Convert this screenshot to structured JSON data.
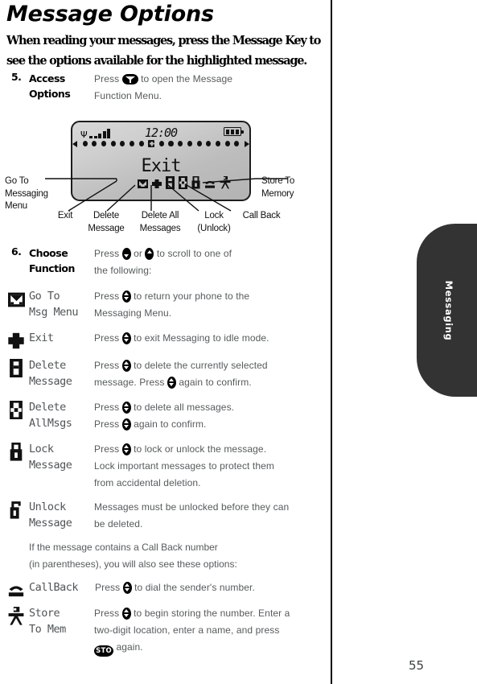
{
  "page": {
    "title": "Message Options",
    "intro": "When reading your messages, press the Message Key to see the options available for the highlighted message.",
    "number": "55",
    "side_tab_label": "Messaging"
  },
  "steps": [
    {
      "num": "5.",
      "label_line1": "Access",
      "label_line2": "Options",
      "body_part1": "Press",
      "body_part2": "to open the Message",
      "body_part3": "Function Menu.",
      "key_icon": "message-key-icon"
    },
    {
      "num": "6.",
      "label_line1": "Choose",
      "label_line2": "Function",
      "body_part1": "Press",
      "body_part2": "or",
      "body_part3": "to scroll to one of",
      "body_part4": "the following:",
      "key_icon_up": "up-arrow-key-icon",
      "key_icon_down": "down-arrow-key-icon"
    }
  ],
  "lcd": {
    "signal_icon": "signal-strength-icon",
    "clock": "12:00",
    "battery_icon": "battery-full-icon",
    "selection_text": "Exit",
    "dot_count_left": 7,
    "dot_count_right": 9,
    "icons": [
      "go-to-messaging-menu-icon",
      "exit-icon",
      "delete-message-icon",
      "delete-all-messages-icon",
      "lock-icon",
      "call-back-icon",
      "store-to-memory-icon"
    ]
  },
  "callouts": {
    "left": "Go To\nMessaging\nMenu",
    "left_l1": "Go To",
    "left_l2": "Messaging",
    "left_l3": "Menu",
    "right_l1": "Store To",
    "right_l2": "Memory",
    "bottom": [
      {
        "l1": "Exit",
        "l2": ""
      },
      {
        "l1": "Delete",
        "l2": "Message"
      },
      {
        "l1": "Delete All",
        "l2": "Messages"
      },
      {
        "l1": "Lock",
        "l2": "(Unlock)"
      },
      {
        "l1": "Call Back",
        "l2": ""
      }
    ]
  },
  "functions": [
    {
      "icon": "go-to-messaging-menu-icon",
      "name_l1": "Go To",
      "name_l2": "Msg Menu",
      "desc_pre": "Press",
      "desc_post": "to return your phone to the",
      "desc_line2": "Messaging Menu."
    },
    {
      "icon": "exit-icon",
      "name_l1": "Exit",
      "name_l2": "",
      "desc_pre": "Press",
      "desc_post": "to exit Messaging to idle mode.",
      "desc_line2": ""
    },
    {
      "icon": "delete-message-icon",
      "name_l1": "Delete",
      "name_l2": "Message",
      "desc_pre": "Press",
      "desc_post": "to delete the currently selected",
      "desc_line2_pre": "message. Press",
      "desc_line2_post": "again to confirm."
    },
    {
      "icon": "delete-all-messages-icon",
      "name_l1": "Delete",
      "name_l2": "AllMsgs",
      "desc_pre": "Press",
      "desc_post": "to delete all messages.",
      "desc_line2_pre": "Press",
      "desc_line2_post": "again to confirm."
    },
    {
      "icon": "lock-message-icon",
      "name_l1": "Lock",
      "name_l2": "Message",
      "desc_pre": "Press",
      "desc_post": "to lock or unlock the message.",
      "desc_line2": "Lock important messages to protect them",
      "desc_line3": "from accidental deletion."
    },
    {
      "icon": "unlock-message-icon",
      "name_l1": "Unlock",
      "name_l2": "Message",
      "desc_line1": "Messages must be unlocked before they can",
      "desc_line2": "be deleted."
    },
    {
      "icon": "call-back-icon",
      "name_l1": "CallBack",
      "name_l2": "",
      "desc_pre": "Press",
      "desc_post": "to dial the sender's number."
    },
    {
      "icon": "store-to-memory-icon",
      "name_l1": "Store",
      "name_l2": "To Mem",
      "desc_pre": "Press",
      "desc_post": "to begin storing the number. Enter a",
      "desc_line2": "two-digit location, enter a name, and press",
      "desc_line3_post": "again.",
      "desc_line3_key": "sto-key-icon"
    }
  ],
  "note": {
    "line1": "If the message contains a Call Back number",
    "line2": "(in parentheses), you will also see these options:"
  }
}
